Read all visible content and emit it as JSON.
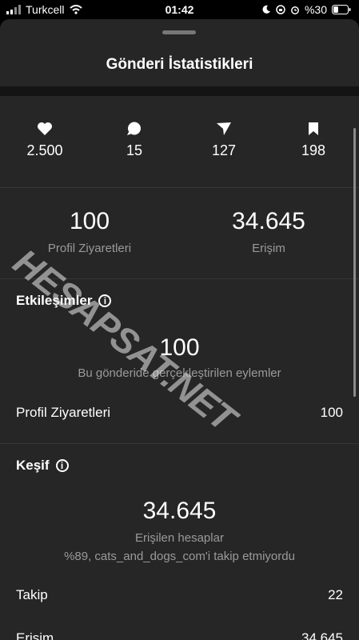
{
  "status_bar": {
    "carrier": "Turkcell",
    "time": "01:42",
    "battery": "%30"
  },
  "sheet": {
    "title": "Gönderi İstatistikleri"
  },
  "interactions": [
    {
      "icon": "heart-icon",
      "value": "2.500"
    },
    {
      "icon": "comment-icon",
      "value": "15"
    },
    {
      "icon": "share-icon",
      "value": "127"
    },
    {
      "icon": "bookmark-icon",
      "value": "198"
    }
  ],
  "summary": {
    "profile_visits_value": "100",
    "profile_visits_label": "Profil Ziyaretleri",
    "reach_value": "34.645",
    "reach_label": "Erişim"
  },
  "engagement": {
    "heading": "Etkileşimler",
    "value": "100",
    "description": "Bu gönderide gerçekleştirilen eylemler",
    "rows": [
      {
        "label": "Profil Ziyaretleri",
        "value": "100"
      }
    ]
  },
  "discovery": {
    "heading": "Keşif",
    "value": "34.645",
    "label": "Erişilen hesaplar",
    "note": "%89, cats_and_dogs_com'i takip etmiyordu",
    "rows": [
      {
        "label": "Takip",
        "value": "22"
      },
      {
        "label": "Erişim",
        "value": "34.645"
      }
    ]
  },
  "watermark": "HESAPSAT.NET"
}
